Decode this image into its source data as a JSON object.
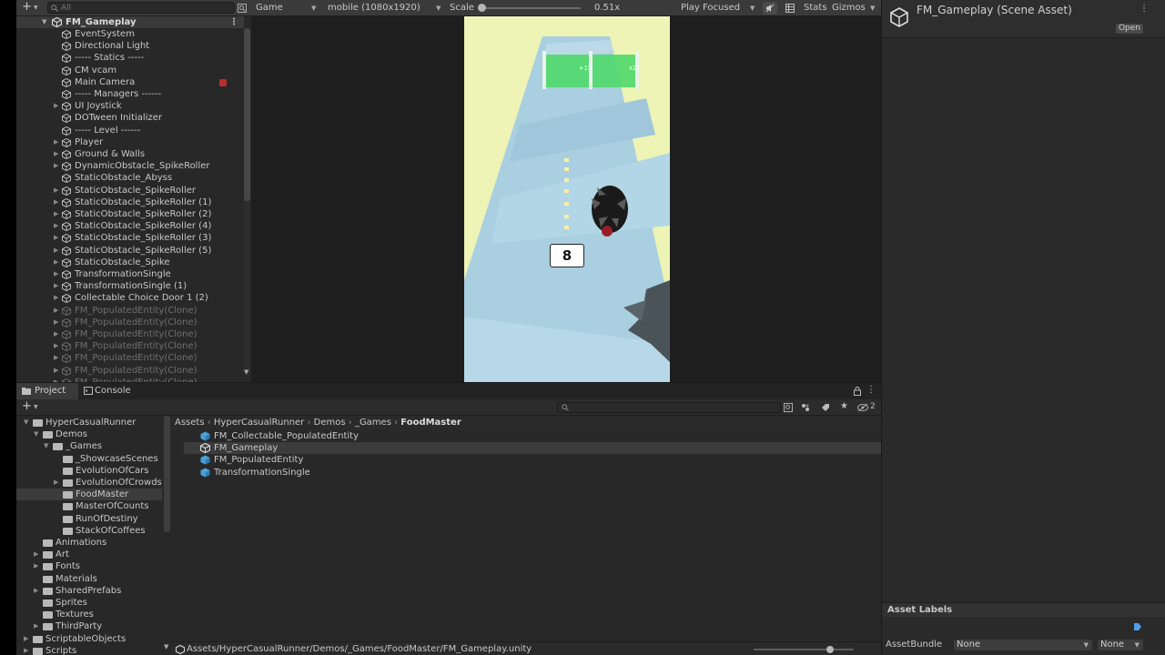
{
  "hierarchy": {
    "search_placeholder": "All",
    "scene": "FM_Gameplay",
    "items": [
      {
        "label": "EventSystem",
        "arrow": false,
        "faded": false
      },
      {
        "label": "Directional Light",
        "arrow": false,
        "faded": false
      },
      {
        "label": "----- Statics -----",
        "arrow": false,
        "faded": false
      },
      {
        "label": "CM vcam",
        "arrow": false,
        "faded": false
      },
      {
        "label": "Main Camera",
        "arrow": false,
        "faded": false
      },
      {
        "label": "----- Managers ------",
        "arrow": false,
        "faded": false
      },
      {
        "label": "UI Joystick",
        "arrow": true,
        "faded": false
      },
      {
        "label": "DOTween Initializer",
        "arrow": false,
        "faded": false
      },
      {
        "label": "----- Level ------",
        "arrow": false,
        "faded": false
      },
      {
        "label": "Player",
        "arrow": true,
        "faded": false
      },
      {
        "label": "Ground & Walls",
        "arrow": true,
        "faded": false
      },
      {
        "label": "DynamicObstacle_SpikeRoller",
        "arrow": true,
        "faded": false
      },
      {
        "label": "StaticObstacle_Abyss",
        "arrow": false,
        "faded": false
      },
      {
        "label": "StaticObstacle_SpikeRoller",
        "arrow": true,
        "faded": false
      },
      {
        "label": "StaticObstacle_SpikeRoller (1)",
        "arrow": true,
        "faded": false
      },
      {
        "label": "StaticObstacle_SpikeRoller (2)",
        "arrow": true,
        "faded": false
      },
      {
        "label": "StaticObstacle_SpikeRoller (4)",
        "arrow": true,
        "faded": false
      },
      {
        "label": "StaticObstacle_SpikeRoller (3)",
        "arrow": true,
        "faded": false
      },
      {
        "label": "StaticObstacle_SpikeRoller (5)",
        "arrow": true,
        "faded": false
      },
      {
        "label": "StaticObstacle_Spike",
        "arrow": true,
        "faded": false
      },
      {
        "label": "TransformationSingle",
        "arrow": true,
        "faded": false
      },
      {
        "label": "TransformationSingle (1)",
        "arrow": true,
        "faded": false
      },
      {
        "label": "Collectable Choice Door 1 (2)",
        "arrow": true,
        "faded": false
      },
      {
        "label": "FM_PopulatedEntity(Clone)",
        "arrow": true,
        "faded": true
      },
      {
        "label": "FM_PopulatedEntity(Clone)",
        "arrow": true,
        "faded": true
      },
      {
        "label": "FM_PopulatedEntity(Clone)",
        "arrow": true,
        "faded": true
      },
      {
        "label": "FM_PopulatedEntity(Clone)",
        "arrow": true,
        "faded": true
      },
      {
        "label": "FM_PopulatedEntity(Clone)",
        "arrow": true,
        "faded": true
      },
      {
        "label": "FM_PopulatedEntity(Clone)",
        "arrow": true,
        "faded": true
      },
      {
        "label": "FM_PopulatedEntity(Clone)",
        "arrow": true,
        "faded": true
      }
    ]
  },
  "game": {
    "tab": "Game",
    "resolution": "mobile (1080x1920)",
    "scale_label": "Scale",
    "scale_value": "0.51x",
    "play_mode": "Play Focused",
    "stats": "Stats",
    "gizmos": "Gizmos",
    "counter": "8",
    "gate_left": "+15",
    "gate_right": "x2"
  },
  "inspector": {
    "title": "FM_Gameplay (Scene Asset)",
    "open": "Open",
    "asset_labels": "Asset Labels",
    "asset_bundle_label": "AssetBundle",
    "asset_bundle_value": "None",
    "variant_value": "None"
  },
  "project": {
    "tab_project": "Project",
    "tab_console": "Console",
    "hidden_count": "2",
    "breadcrumb": [
      "Assets",
      "HyperCasualRunner",
      "Demos",
      "_Games",
      "FoodMaster"
    ],
    "tree": [
      {
        "label": "HyperCasualRunner",
        "indent": 0,
        "arrow": true,
        "selected": false
      },
      {
        "label": "Demos",
        "indent": 1,
        "arrow": true,
        "selected": false
      },
      {
        "label": "_Games",
        "indent": 2,
        "arrow": true,
        "selected": false
      },
      {
        "label": "_ShowcaseScenes",
        "indent": 3,
        "arrow": false,
        "selected": false
      },
      {
        "label": "EvolutionOfCars",
        "indent": 3,
        "arrow": false,
        "selected": false
      },
      {
        "label": "EvolutionOfCrowds",
        "indent": 3,
        "arrow": true,
        "selected": false
      },
      {
        "label": "FoodMaster",
        "indent": 3,
        "arrow": false,
        "selected": true
      },
      {
        "label": "MasterOfCounts",
        "indent": 3,
        "arrow": false,
        "selected": false
      },
      {
        "label": "RunOfDestiny",
        "indent": 3,
        "arrow": false,
        "selected": false
      },
      {
        "label": "StackOfCoffees",
        "indent": 3,
        "arrow": false,
        "selected": false
      },
      {
        "label": "Animations",
        "indent": 1,
        "arrow": false,
        "selected": false
      },
      {
        "label": "Art",
        "indent": 1,
        "arrow": true,
        "selected": false
      },
      {
        "label": "Fonts",
        "indent": 1,
        "arrow": true,
        "selected": false
      },
      {
        "label": "Materials",
        "indent": 1,
        "arrow": false,
        "selected": false
      },
      {
        "label": "SharedPrefabs",
        "indent": 1,
        "arrow": true,
        "selected": false
      },
      {
        "label": "Sprites",
        "indent": 1,
        "arrow": false,
        "selected": false
      },
      {
        "label": "Textures",
        "indent": 1,
        "arrow": false,
        "selected": false
      },
      {
        "label": "ThirdParty",
        "indent": 1,
        "arrow": true,
        "selected": false
      },
      {
        "label": "ScriptableObjects",
        "indent": 0,
        "arrow": true,
        "selected": false
      },
      {
        "label": "Scripts",
        "indent": 0,
        "arrow": true,
        "selected": false
      }
    ],
    "assets": [
      {
        "label": "FM_Collectable_PopulatedEntity",
        "type": "prefab",
        "selected": false
      },
      {
        "label": "FM_Gameplay",
        "type": "scene",
        "selected": true
      },
      {
        "label": "FM_PopulatedEntity",
        "type": "prefab",
        "selected": false
      },
      {
        "label": "TransformationSingle",
        "type": "prefab",
        "selected": false
      }
    ],
    "footer_path": "Assets/HyperCasualRunner/Demos/_Games/FoodMaster/FM_Gameplay.unity"
  }
}
